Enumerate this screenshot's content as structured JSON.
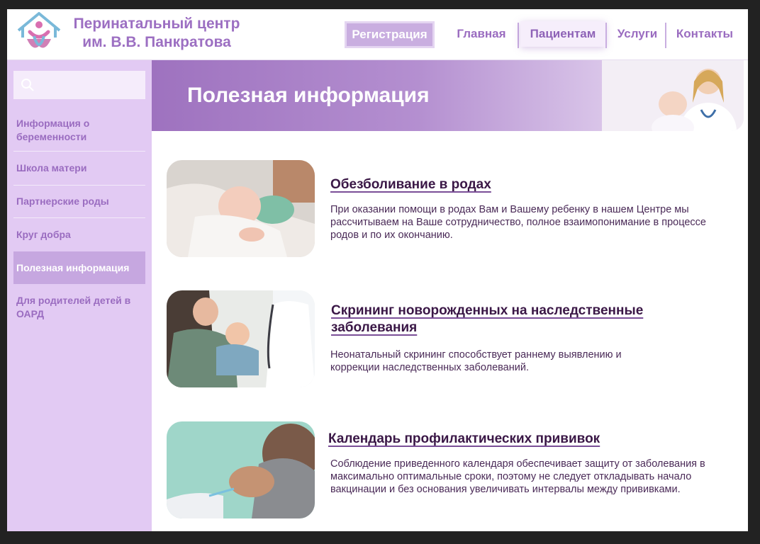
{
  "header": {
    "brand_line1": "Перинатальный центр",
    "brand_line2": "им. В.В. Панкратова",
    "nav": {
      "register": "Регистрация",
      "home": "Главная",
      "patients": "Пациентам",
      "services": "Услуги",
      "contacts": "Контакты"
    }
  },
  "sidebar": {
    "search": {
      "placeholder": ""
    },
    "items": [
      {
        "label": "Информация о беременности"
      },
      {
        "label": "Школа матери"
      },
      {
        "label": "Партнерские роды"
      },
      {
        "label": "Круг добра"
      },
      {
        "label": "Полезная информация"
      },
      {
        "label": "Для родителей детей в ОАРД"
      }
    ]
  },
  "banner": {
    "title": "Полезная информация"
  },
  "articles": [
    {
      "title": "Обезболивание в родах",
      "text": "При оказании помощи в родах Вам и Вашему ребенку в нашем Центре мы рассчитываем на Ваше сотрудничество, полное взаимопонимание в процессе родов и по их окончанию."
    },
    {
      "title_line1": "Скрининг новорожденных на наследственные",
      "title_line2": "заболевания",
      "text": "Неонатальный скрининг способствует раннему выявлению и коррекции наследственных заболеваний."
    },
    {
      "title": "Календарь профилактических прививок",
      "text": "Соблюдение приведенного календаря обеспечивает защиту от заболевания в максимально оптимальные сроки, поэтому не следует откладывать начало вакцинации и без основания увеличивать интервалы между прививками."
    }
  ],
  "colors": {
    "accent": "#9a6cc0",
    "sidebar_bg": "#e2caf3",
    "active_item": "#c6a7e0",
    "title_text": "#3a1746"
  },
  "icons": [
    "logo-icon",
    "search-icon"
  ]
}
